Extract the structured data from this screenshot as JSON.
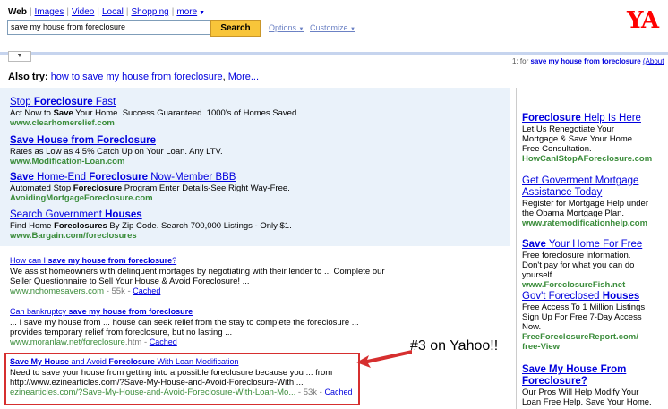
{
  "tabs": [
    "Web",
    "Images",
    "Video",
    "Local",
    "Shopping",
    "more"
  ],
  "search": {
    "query": "save my house from foreclosure",
    "button": "Search"
  },
  "header": {
    "options": "Options",
    "customize": "Customize",
    "logo": "YA"
  },
  "result_count": {
    "prefix": "1",
    "mid": "for",
    "query": "save my house from foreclosure",
    "about": "(About"
  },
  "also_try": {
    "label": "Also try:",
    "link": "how to save my house from foreclosure",
    "more": "More..."
  },
  "sponsored_top": [
    {
      "title_pre": "Stop ",
      "title_b": "Foreclosure",
      "title_post": " Fast",
      "desc_pre": "Act Now to ",
      "desc_b": "Save",
      "desc_post": " Your Home. Success Guaranteed. 1000's of Homes Saved.",
      "url": "www.clearhomerelief.com"
    },
    {
      "title_b": "Save House from Foreclosure",
      "desc": "Rates as Low as 4.5% Catch Up on Your Loan. Any LTV.",
      "url": "www.Modification-Loan.com"
    },
    {
      "title_b1": "Save",
      "title_mid": " Home-End ",
      "title_b2": "Foreclosure",
      "title_post": " Now-Member BBB",
      "desc_pre": "Automated Stop ",
      "desc_b": "Foreclosure",
      "desc_post": " Program Enter Details-See Right Way-Free.",
      "url": "AvoidingMortgageForeclosure.com"
    },
    {
      "title_pre": "Search Government ",
      "title_b": "Houses",
      "desc_pre": "Find Home ",
      "desc_b": "Foreclosures",
      "desc_post": " By Zip Code. Search 700,000 Listings - Only $1.",
      "url": "www.Bargain.com/foreclosures"
    }
  ],
  "results": [
    {
      "title_pre": "How can I ",
      "title_b": "save my house from foreclosure",
      "title_post": "?",
      "line1": "We assist homeowners with delinquent mortages by negotiating with their lender to ... Complete our",
      "line2": "Seller Questionnaire to Sell Your House & Avoid Foreclosure! ...",
      "url": "www.nchomesavers.com",
      "size": "55k",
      "cached": "Cached"
    },
    {
      "title_pre": "Can bankruptcy ",
      "title_b": "save my house from foreclosure",
      "line1": "... I save my house from ... house can seek relief from the stay to complete the foreclosure ...",
      "line2": "provides temporary relief from foreclosure, but no lasting ...",
      "url": "www.moranlaw.net/foreclosure",
      "url_ext": ".htm",
      "size": "",
      "cached": "Cached"
    },
    {
      "title_b1": "Save My House",
      "title_mid": " and Avoid ",
      "title_b2": "Foreclosure",
      "title_post": " With Loan Modification",
      "line1": "Need to save your house from getting into a possible foreclosure because you ... from",
      "line2": "http://www.ezinearticles.com/?Save-My-House-and-Avoid-Foreclosure-With ...",
      "url": "ezinearticles.com/?Save-My-House-and-Avoid-Foreclosure-With-Loan-Mo...",
      "size": "53k",
      "cached": "Cached"
    }
  ],
  "sponsored_right": [
    {
      "title_b": "Foreclosure",
      "title_post": " Help Is Here",
      "desc": "Let Us Renegotiate Your Mortgage & Save Your Home. Free Consultation.",
      "url": "HowCanIStopAForeclosure.com"
    },
    {
      "title": "Get Goverment Mortgage Assistance Today",
      "desc": "Register for Mortgage Help under the Obama Mortgage Plan.",
      "url": "www.ratemodificationhelp.com"
    },
    {
      "title_b": "Save",
      "title_post": " Your Home For Free",
      "desc": "Free foreclosure information. Don't pay for what you can do yourself.",
      "url": "www.ForeclosureFish.net"
    },
    {
      "title_pre": "Gov't Foreclosed ",
      "title_b": "Houses",
      "desc": "Free Access To 1 Million Listings Sign Up For Free 7-Day Access Now.",
      "url": "FreeForeclosureReport.com/",
      "url2": "free-View"
    },
    {
      "title_b": "Save My House From Foreclosure?",
      "desc": "Our Pros Will Help Modify Your Loan Free Help. Save Your Home."
    }
  ],
  "callout": "#3 on Yahoo!!"
}
